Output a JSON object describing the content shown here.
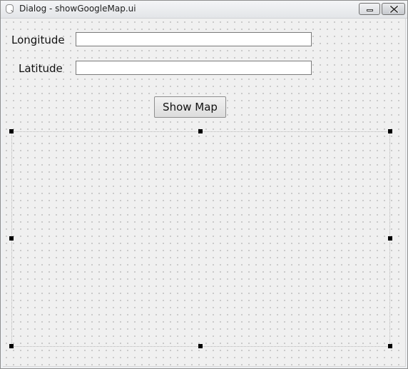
{
  "window": {
    "title": "Dialog - showGoogleMap.ui",
    "icons": {
      "app": "qt-designer-icon",
      "minimize": "minimize-icon",
      "close": "close-icon"
    }
  },
  "form": {
    "longitude": {
      "label": "Longitude",
      "value": "",
      "placeholder": ""
    },
    "latitude": {
      "label": "Latitude",
      "value": "",
      "placeholder": ""
    },
    "show_map_button": "Show Map"
  },
  "colors": {
    "client_background": "#f0f0f0",
    "grid_dots": "#9a9a9a",
    "selection_handle": "#000000"
  }
}
